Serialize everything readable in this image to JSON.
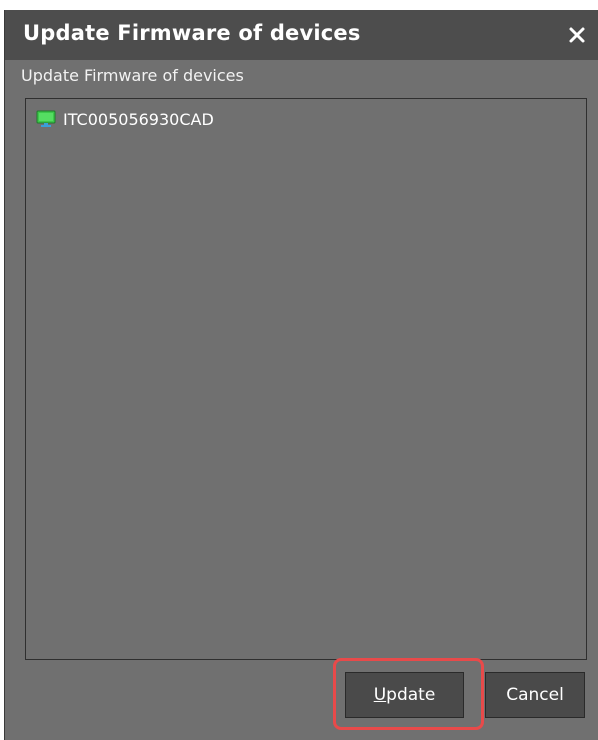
{
  "dialog": {
    "title": "Update Firmware of devices",
    "subtitle": "Update Firmware of devices"
  },
  "device_list": {
    "items": [
      {
        "label": "ITC005056930CAD",
        "icon": "monitor-icon"
      }
    ]
  },
  "buttons": {
    "update_first": "U",
    "update_rest": "pdate",
    "cancel": "Cancel"
  },
  "colors": {
    "titlebar": "#4d4d4d",
    "body": "#707070",
    "highlight": "#e84a4a",
    "monitor_icon": "#3cc84a"
  }
}
